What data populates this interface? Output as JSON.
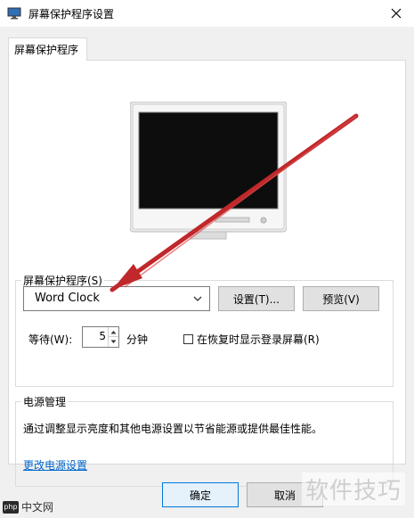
{
  "window": {
    "title": "屏幕保护程序设置"
  },
  "tab": {
    "label": "屏幕保护程序"
  },
  "screensaver": {
    "group_label": "屏幕保护程序(S)",
    "selected": "Word Clock",
    "settings_button": "设置(T)...",
    "preview_button": "预览(V)",
    "wait_label": "等待(W):",
    "wait_value": "5",
    "minutes_label": "分钟",
    "resume_checkbox_label": "在恢复时显示登录屏幕(R)",
    "resume_checked": false
  },
  "power": {
    "group_label": "电源管理",
    "description": "通过调整显示亮度和其他电源设置以节省能源或提供最佳性能。",
    "link": "更改电源设置"
  },
  "footer": {
    "ok_button": "确定",
    "cancel_button": "取消"
  },
  "overlay": {
    "watermark": "软件技巧",
    "logo_text": "中文网",
    "logo_badge": "php",
    "arrow_color": "#c0282b"
  }
}
